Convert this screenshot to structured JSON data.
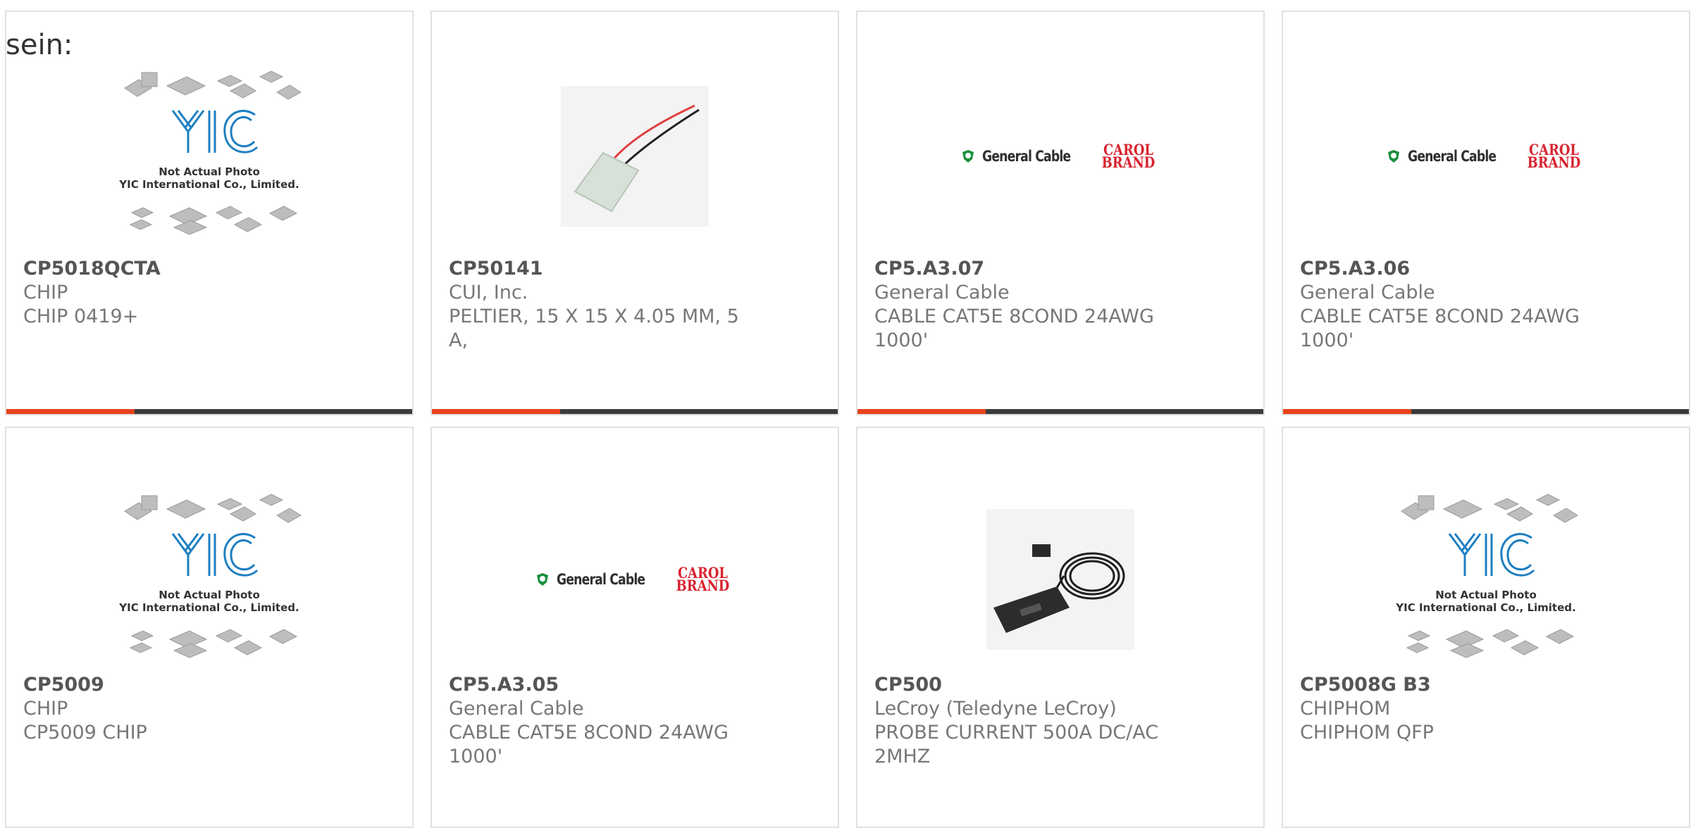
{
  "lead_text": "sein:",
  "yic_logo": {
    "brand": "YIC",
    "line1": "Not Actual Photo",
    "line2": "YIC International Co., Limited."
  },
  "gc_logo": {
    "brand": "General Cable",
    "sub1": "CAROL",
    "sub2": "BRAND"
  },
  "products": [
    {
      "part_number": "CP5018QCTA",
      "manufacturer": "CHIP",
      "description": "CHIP 0419+",
      "image": "yic-placeholder"
    },
    {
      "part_number": "CP50141",
      "manufacturer": "CUI, Inc.",
      "description": "PELTIER, 15 X 15 X 4.05 MM, 5 A,",
      "image": "peltier-module"
    },
    {
      "part_number": "CP5.A3.07",
      "manufacturer": "General Cable",
      "description": "CABLE CAT5E 8COND 24AWG 1000'",
      "image": "general-cable-logo"
    },
    {
      "part_number": "CP5.A3.06",
      "manufacturer": "General Cable",
      "description": "CABLE CAT5E 8COND 24AWG 1000'",
      "image": "general-cable-logo"
    },
    {
      "part_number": "CP5009",
      "manufacturer": "CHIP",
      "description": "CP5009 CHIP",
      "image": "yic-placeholder"
    },
    {
      "part_number": "CP5.A3.05",
      "manufacturer": "General Cable",
      "description": "CABLE CAT5E 8COND 24AWG 1000'",
      "image": "general-cable-logo"
    },
    {
      "part_number": "CP500",
      "manufacturer": "LeCroy (Teledyne LeCroy)",
      "description": "PROBE CURRENT 500A DC/AC 2MHZ",
      "image": "current-probe"
    },
    {
      "part_number": "CP5008G B3",
      "manufacturer": "CHIPHOM",
      "description": "CHIPHOM QFP",
      "image": "yic-placeholder"
    }
  ],
  "colors": {
    "accent": "#e8421a",
    "bar": "#3b3b3b",
    "border": "#e1e1e1"
  }
}
